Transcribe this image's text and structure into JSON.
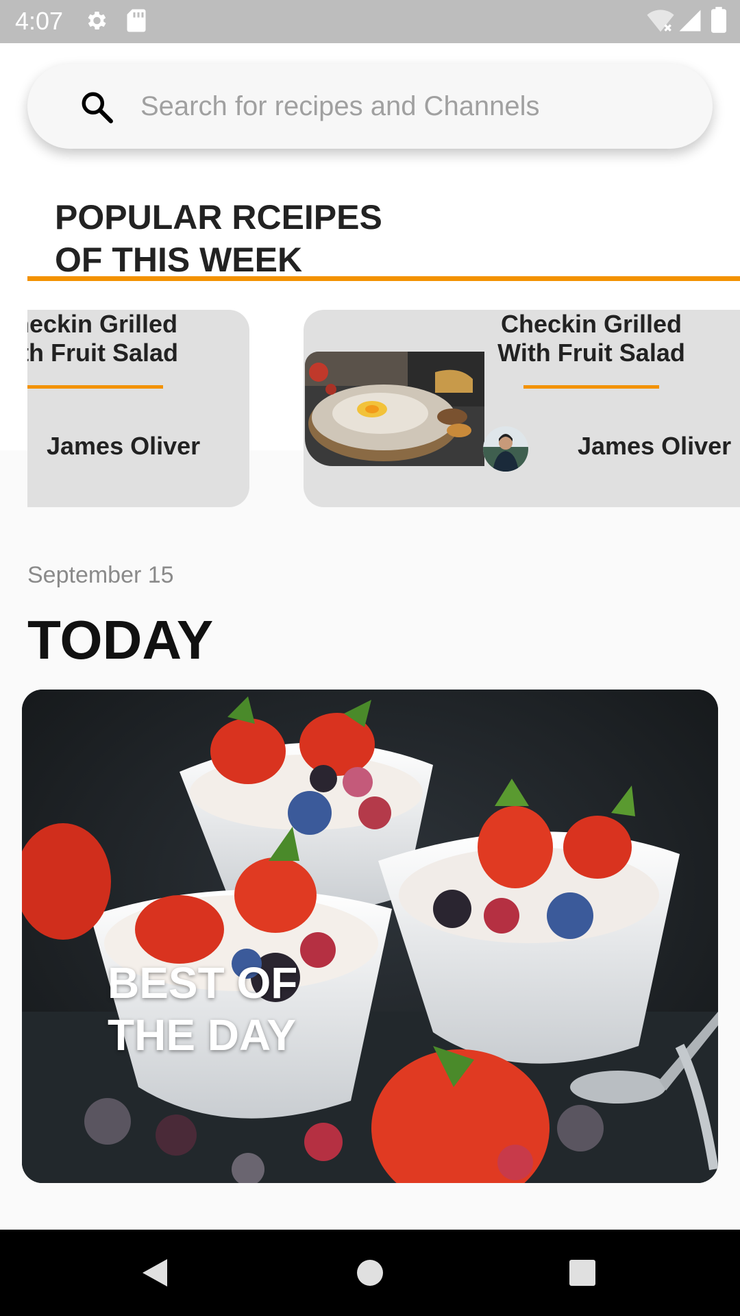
{
  "status_bar": {
    "time": "4:07"
  },
  "search": {
    "placeholder": "Search for recipes and Channels"
  },
  "popular": {
    "title_line1": "POPULAR RCEIPES",
    "title_line2": "OF THIS WEEK"
  },
  "cards": [
    {
      "title_line1": "heckin Grilled",
      "title_line2": "ith Fruit Salad",
      "author": "James Oliver"
    },
    {
      "title_line1": "Checkin Grilled",
      "title_line2": "With Fruit Salad",
      "author": "James Oliver"
    }
  ],
  "today": {
    "date": "September 15",
    "heading": "TODAY",
    "best_line1": "BEST OF",
    "best_line2": "THE DAY"
  },
  "colors": {
    "accent": "#f39200",
    "card_bg": "#e0e0e0",
    "status_bar": "#bdbdbd",
    "nav_bar": "#000000"
  },
  "icons": {
    "status": [
      "gear-icon",
      "sd-card-icon",
      "wifi-off-icon",
      "signal-icon",
      "battery-icon"
    ],
    "search": "search-icon",
    "nav": [
      "back-icon",
      "home-icon",
      "recents-icon"
    ]
  }
}
